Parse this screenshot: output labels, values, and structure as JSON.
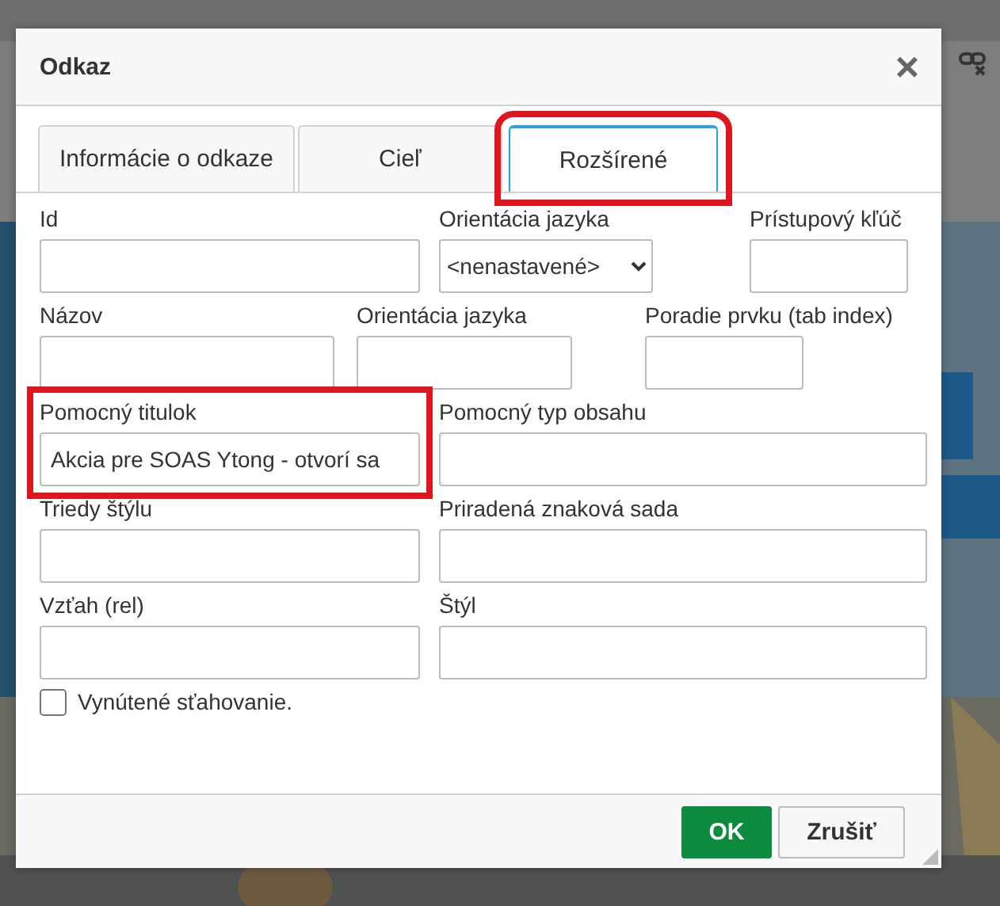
{
  "dialog": {
    "title": "Odkaz",
    "close": "×",
    "tabs": [
      {
        "label": "Informácie o odkaze",
        "selected": false,
        "highlighted": false
      },
      {
        "label": "Cieľ",
        "selected": false,
        "highlighted": false
      },
      {
        "label": "Rozšírené",
        "selected": true,
        "highlighted": true
      }
    ],
    "rows": [
      [
        {
          "label": "Id",
          "kind": "text",
          "highlighted": false
        },
        {
          "label": "Orientácia jazyka",
          "kind": "select",
          "value": "<nenastavené>",
          "highlighted": false
        },
        {
          "label": "Prístupový kľúč",
          "kind": "text",
          "highlighted": false
        }
      ],
      [
        {
          "label": "Názov",
          "kind": "text",
          "highlighted": false
        },
        {
          "label": "Orientácia jazyka",
          "kind": "text",
          "highlighted": false
        },
        {
          "label": "Poradie prvku (tab index)",
          "kind": "text",
          "highlighted": false
        }
      ],
      [
        {
          "label": "Pomocný titulok",
          "kind": "text",
          "value": "Akcia pre SOAS Ytong - otvorí sa",
          "highlighted": true
        },
        {
          "label": "Pomocný typ obsahu",
          "kind": "text",
          "highlighted": false
        }
      ],
      [
        {
          "label": "Triedy štýlu",
          "kind": "text",
          "highlighted": false
        },
        {
          "label": "Priradená znaková sada",
          "kind": "text",
          "highlighted": false
        }
      ],
      [
        {
          "label": "Vzťah (rel)",
          "kind": "text",
          "highlighted": false
        },
        {
          "label": "Štýl",
          "kind": "text",
          "highlighted": false
        }
      ]
    ],
    "checkbox": {
      "label": "Vynútené sťahovanie.",
      "checked": false
    },
    "buttons": [
      {
        "label": "OK",
        "kind": "primary"
      },
      {
        "label": "Zrušiť",
        "kind": "secondary"
      }
    ]
  }
}
